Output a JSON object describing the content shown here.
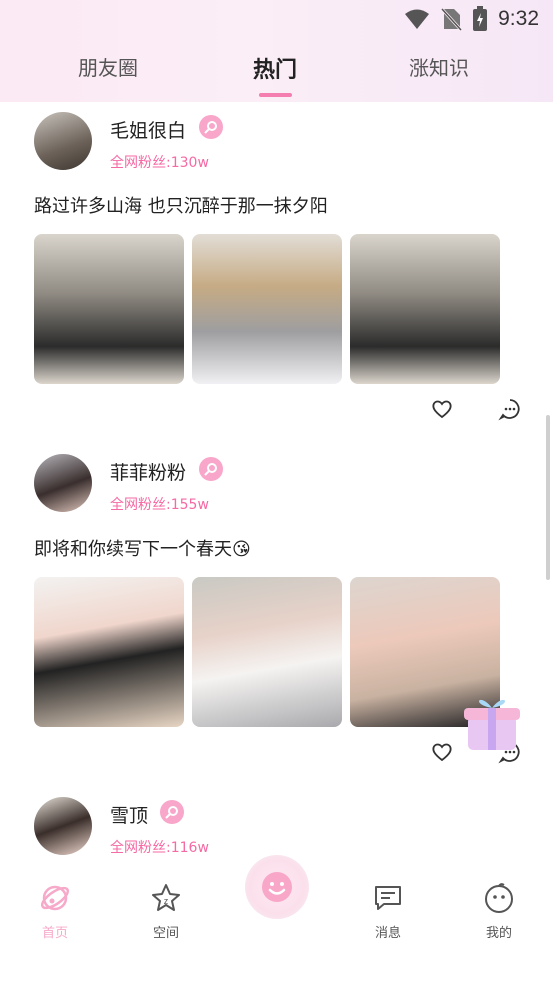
{
  "status_bar": {
    "time": "9:32"
  },
  "tabs": [
    "朋友圈",
    "热门",
    "涨知识"
  ],
  "posts": [
    {
      "username": "毛姐很白",
      "fans": "全网粉丝:130w",
      "text": "路过许多山海 也只沉醉于那一抹夕阳"
    },
    {
      "username": "菲菲粉粉",
      "fans": "全网粉丝:155w",
      "text": "即将和你续写下一个春天😘"
    },
    {
      "username": "雪顶",
      "fans": "全网粉丝:116w",
      "text": ""
    }
  ],
  "nav": [
    "首页",
    "空间",
    "消息",
    "我的"
  ],
  "colors": {
    "accent": "#f47eb0",
    "fans_text": "#f56aa4",
    "badge": "#f8a6c9"
  }
}
